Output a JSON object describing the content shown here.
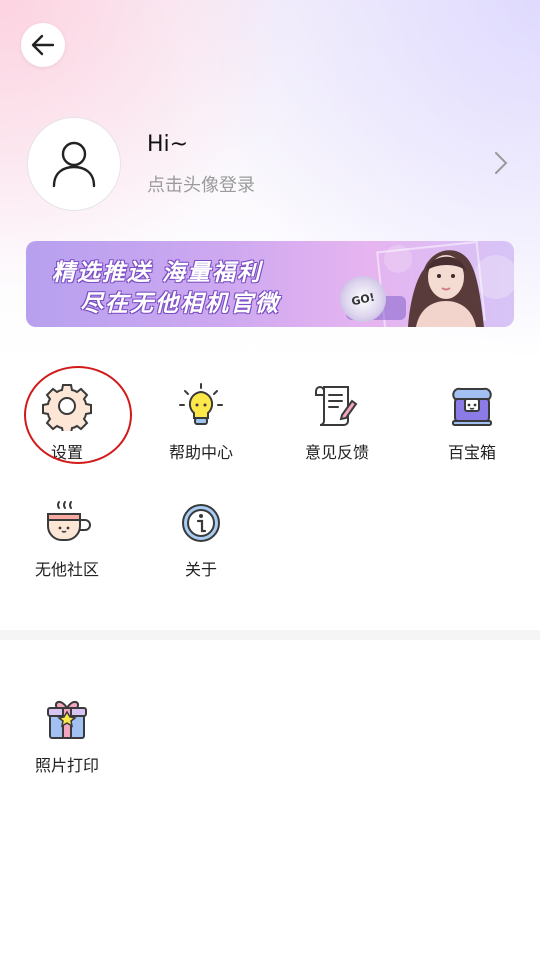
{
  "profile": {
    "greeting": "Hi~",
    "login_hint": "点击头像登录"
  },
  "banner": {
    "line1": "精选推送 海量福利",
    "line2": "尽在无他相机官微",
    "badge": "GO!"
  },
  "menu": {
    "items": [
      {
        "label": "设置",
        "icon": "gear-icon"
      },
      {
        "label": "帮助中心",
        "icon": "lightbulb-icon"
      },
      {
        "label": "意见反馈",
        "icon": "feedback-scroll-icon"
      },
      {
        "label": "百宝箱",
        "icon": "treasure-chest-icon"
      },
      {
        "label": "无他社区",
        "icon": "coffee-cup-icon"
      },
      {
        "label": "关于",
        "icon": "info-icon"
      }
    ]
  },
  "extras": {
    "items": [
      {
        "label": "照片打印",
        "icon": "gift-box-icon"
      }
    ]
  },
  "colors": {
    "highlight": "#d11b1b",
    "banner_purple": "#b7a0ef"
  }
}
